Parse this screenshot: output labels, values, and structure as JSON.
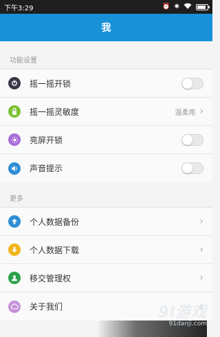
{
  "status_bar": {
    "time": "下午3:29",
    "icons": [
      "alarm-icon",
      "bluetooth-icon",
      "wifi-icon",
      "battery-icon"
    ],
    "battery_level": 0.85
  },
  "title_bar": {
    "title": "我",
    "color": "#1891d8"
  },
  "sections": [
    {
      "label": "功能设置",
      "items": [
        {
          "label": "摇一摇开锁",
          "icon": "shake-unlock-icon",
          "icon_color": "#3a3a4a",
          "control": "toggle",
          "on": false
        },
        {
          "label": "摇一摇灵敏度",
          "icon": "sensitivity-icon",
          "icon_color": "#7cc234",
          "control": "value",
          "value": "温柔用"
        },
        {
          "label": "亮屏开锁",
          "icon": "screen-brightness-icon",
          "icon_color": "#a76cd8",
          "control": "toggle",
          "on": false
        },
        {
          "label": "声音提示",
          "icon": "speaker-icon",
          "icon_color": "#2f8fd6",
          "control": "toggle",
          "on": false
        }
      ]
    },
    {
      "label": "更多",
      "items": [
        {
          "label": "个人数据备份",
          "icon": "upload-icon",
          "icon_color": "#2f8fd6",
          "control": "chevron"
        },
        {
          "label": "个人数据下载",
          "icon": "download-icon",
          "icon_color": "#f2b51a",
          "control": "chevron"
        },
        {
          "label": "移交管理权",
          "icon": "user-icon",
          "icon_color": "#2aa24b",
          "control": "chevron"
        },
        {
          "label": "关于我们",
          "icon": "cloud-icon",
          "icon_color": "#c490d8",
          "control": "chevron"
        }
      ]
    }
  ],
  "watermark": {
    "logo": "9l游戏",
    "url": "91danji.com"
  }
}
